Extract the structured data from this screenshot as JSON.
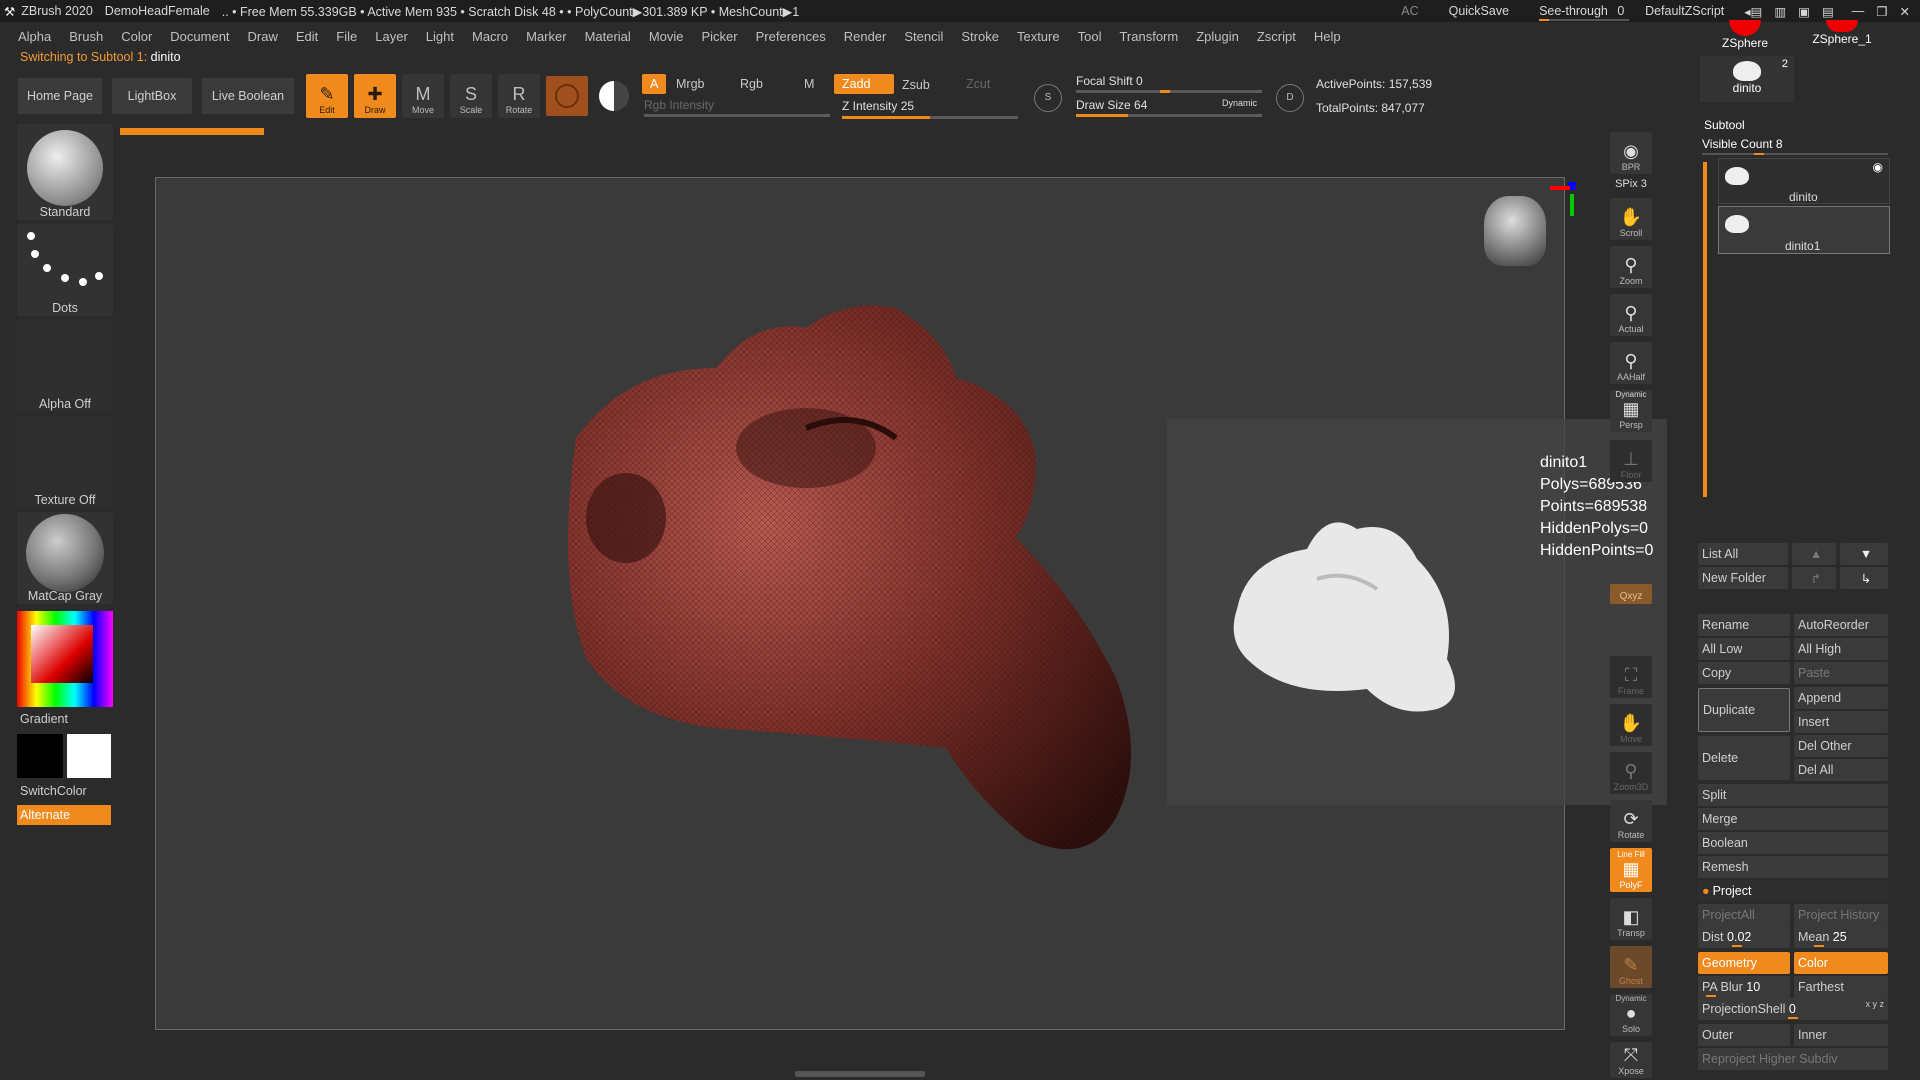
{
  "titlebar": {
    "app": "ZBrush 2020",
    "doc": "DemoHeadFemale",
    "stats": ".. • Free Mem 55.339GB • Active Mem 935 • Scratch Disk 48 • • PolyCount▶301.389 KP • MeshCount▶1",
    "ac": "AC",
    "quicksave": "QuickSave",
    "seethrough": "See-through",
    "seethrough_value": "0",
    "script": "DefaultZScript"
  },
  "menu": [
    "Alpha",
    "Brush",
    "Color",
    "Document",
    "Draw",
    "Edit",
    "File",
    "Layer",
    "Light",
    "Macro",
    "Marker",
    "Material",
    "Movie",
    "Picker",
    "Preferences",
    "Render",
    "Stencil",
    "Stroke",
    "Texture",
    "Tool",
    "Transform",
    "Zplugin",
    "Zscript",
    "Help"
  ],
  "status": {
    "label": "Switching to Subtool 1:",
    "value": "dinito"
  },
  "toolbar": {
    "home": "Home Page",
    "lightbox": "LightBox",
    "live_boolean": "Live Boolean",
    "tools": [
      {
        "label": "Edit",
        "icon": "✎",
        "on": true
      },
      {
        "label": "Draw",
        "icon": "✚",
        "on": true
      },
      {
        "label": "Move",
        "icon": "M",
        "on": false
      },
      {
        "label": "Scale",
        "icon": "S",
        "on": false
      },
      {
        "label": "Rotate",
        "icon": "R",
        "on": false
      }
    ],
    "a": "A",
    "mrgb": "Mrgb",
    "rgb": "Rgb",
    "m": "M",
    "zadd": "Zadd",
    "zsub": "Zsub",
    "zcut": "Zcut",
    "rgb_intensity": "Rgb Intensity",
    "z_intensity_label": "Z Intensity",
    "z_intensity": "25",
    "focal_label": "Focal Shift",
    "focal": "0",
    "drawsize_label": "Draw Size",
    "drawsize": "64",
    "dynamic": "Dynamic",
    "active_points": "ActivePoints: 157,539",
    "total_points": "TotalPoints: 847,077"
  },
  "left": {
    "standard": "Standard",
    "dots": "Dots",
    "alpha": "Alpha Off",
    "texture": "Texture Off",
    "matcap": "MatCap Gray",
    "gradient": "Gradient",
    "switchcolor": "SwitchColor",
    "alternate": "Alternate"
  },
  "tooltip": {
    "name": "dinito1",
    "polys": "Polys=689536",
    "points": "Points=689538",
    "hiddenpolys": "HiddenPolys=0",
    "hiddenpoints": "HiddenPoints=0"
  },
  "dock": {
    "bpr": "BPR",
    "spix": "SPix 3",
    "scroll": "Scroll",
    "zoom": "Zoom",
    "actual": "Actual",
    "aahalf": "AAHalf",
    "dynamic": "Dynamic",
    "persp": "Persp",
    "floor": "Floor",
    "xyz": "Qxyz",
    "frame": "Frame",
    "move": "Move",
    "zoom3d": "Zoom3D",
    "rotate": "Rotate",
    "linefill": "Line Fill",
    "polyf": "PolyF",
    "transp": "Transp",
    "ghost": "Ghost",
    "solo_dyn": "Dynamic",
    "solo": "Solo",
    "xpose": "Xpose"
  },
  "panel": {
    "zsphere": "ZSphere",
    "zsphere1": "ZSphere_1",
    "dinito_thumb": "dinito",
    "thumb_count": "2",
    "subtool": "Subtool",
    "visible_count": "Visible Count 8",
    "items": [
      "dinito",
      "dinito1"
    ],
    "list_all": "List All",
    "new_folder": "New Folder",
    "rename": "Rename",
    "autoreorder": "AutoReorder",
    "all_low": "All Low",
    "all_high": "All High",
    "copy": "Copy",
    "paste": "Paste",
    "duplicate": "Duplicate",
    "append": "Append",
    "insert": "Insert",
    "delete": "Delete",
    "del_other": "Del Other",
    "del_all": "Del All",
    "split": "Split",
    "merge": "Merge",
    "boolean": "Boolean",
    "remesh": "Remesh",
    "project": "Project",
    "projectall": "ProjectAll",
    "project_history": "Project History",
    "dist_label": "Dist",
    "dist": "0.02",
    "mean_label": "Mean",
    "mean": "25",
    "geometry": "Geometry",
    "color": "Color",
    "pablur_label": "PA Blur",
    "pablur": "10",
    "farthest": "Farthest",
    "projshell_label": "ProjectionShell",
    "projshell": "0",
    "outer": "Outer",
    "inner": "Inner",
    "reproject": "Reproject Higher Subdiv"
  },
  "colors": {
    "accent": "#f08a1c",
    "mesh": "#7a2e28",
    "panel": "#3a3a3a"
  }
}
